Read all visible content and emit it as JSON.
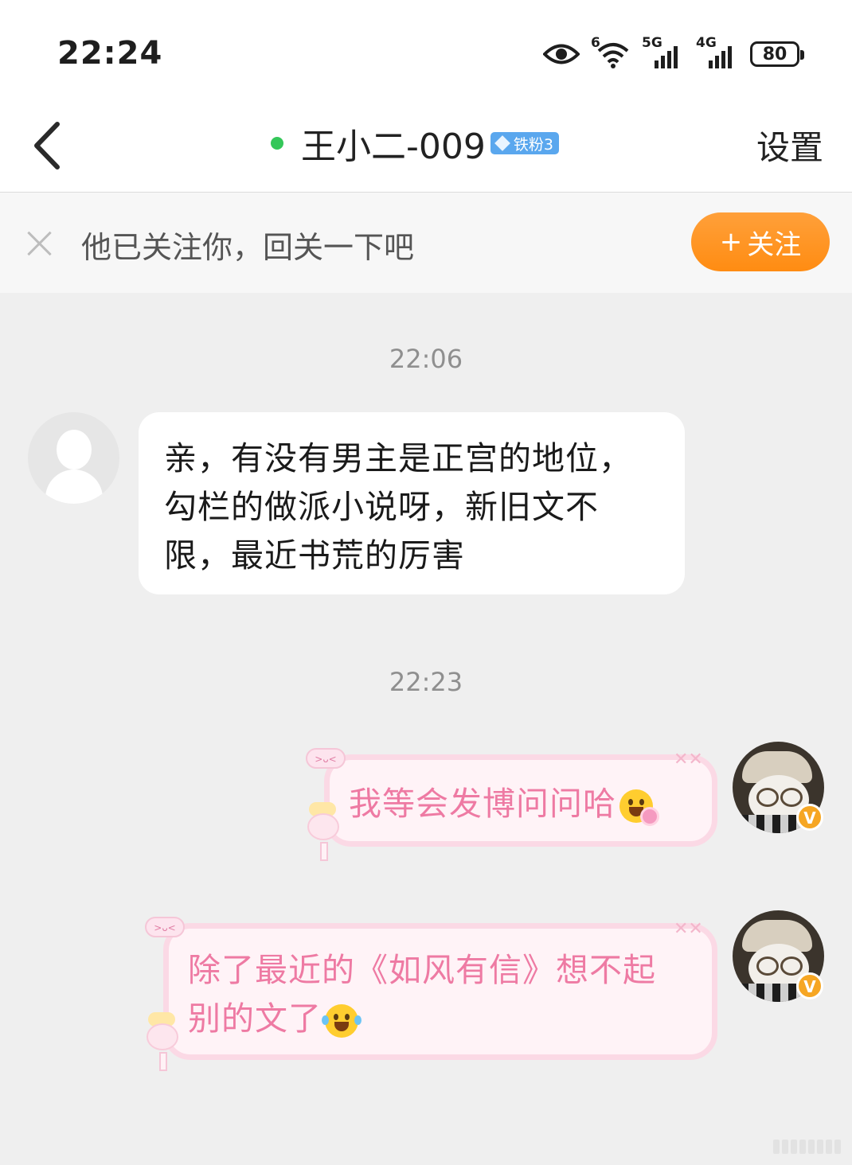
{
  "status_bar": {
    "time": "22:24",
    "wifi_label": "6",
    "network1": "5G",
    "network2": "4G",
    "battery": "80",
    "icons": [
      "eye-icon",
      "wifi-icon",
      "signal-5g-icon",
      "signal-4g-icon",
      "battery-icon"
    ]
  },
  "header": {
    "back_icon": "chevron-left-icon",
    "online": true,
    "title": "王小二-009",
    "fan_badge": "铁粉3",
    "settings": "设置"
  },
  "follow_bar": {
    "text": "他已关注你，回关一下吧",
    "button_plus": "+",
    "button_label": "关注"
  },
  "messages": [
    {
      "type": "time",
      "text": "22:06"
    },
    {
      "type": "incoming",
      "lines": [
        "亲，有没有男主是正宫的地位，",
        "勾栏的做派小说呀，新旧文不",
        "限，最近书荒的厉害"
      ]
    },
    {
      "type": "time",
      "text": "22:23"
    },
    {
      "type": "outgoing",
      "lines": [
        "我等会发博问问哈"
      ],
      "emoji": "smile-flower-emoji"
    },
    {
      "type": "outgoing",
      "lines": [
        "除了最近的《如风有信》想不起",
        "别的文了"
      ],
      "emoji": "laugh-cry-emoji"
    }
  ],
  "deco": {
    "tag": ">ᴗ<",
    "x": "✕✕",
    "vbadge": "V"
  },
  "colors": {
    "accent_orange": "#ff8c12",
    "online_green": "#34c759",
    "badge_blue": "#5aa7ee",
    "bubble_pink_text": "#ee7aa3"
  }
}
